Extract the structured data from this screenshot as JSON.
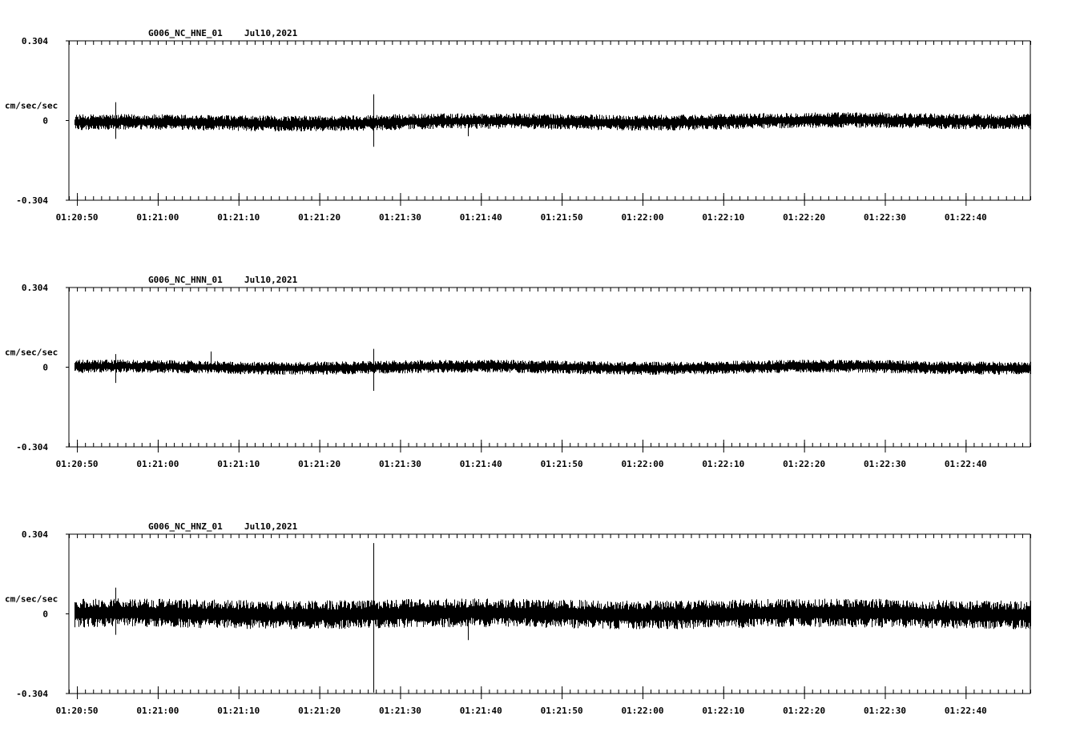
{
  "chart_data": [
    {
      "type": "line",
      "title": "G006_NC_HNE_01",
      "date": "Jul10,2021",
      "ylabel": "cm/sec/sec",
      "ylim": [
        -0.304,
        0.304
      ],
      "y_ticks": [
        "0.304",
        "0",
        "-0.304"
      ],
      "x_ticks": [
        "01:20:50",
        "01:21:00",
        "01:21:10",
        "01:21:20",
        "01:21:30",
        "01:21:40",
        "01:21:50",
        "01:22:00",
        "01:22:10",
        "01:22:20",
        "01:22:30",
        "01:22:40"
      ],
      "x_start_s": 49.0,
      "x_end_s": 168.0,
      "record_start_s": 49.7,
      "noise_amplitude": 0.03,
      "baseline_offset": -0.01,
      "spikes": [
        {
          "t": 54.8,
          "max": 0.07,
          "min": -0.07
        },
        {
          "t": 86.7,
          "max": 0.1,
          "min": -0.1
        },
        {
          "t": 98.4,
          "max": 0.02,
          "min": -0.06
        }
      ],
      "grid": false
    },
    {
      "type": "line",
      "title": "G006_NC_HNN_01",
      "date": "Jul10,2021",
      "ylabel": "cm/sec/sec",
      "ylim": [
        -0.304,
        0.304
      ],
      "y_ticks": [
        "0.304",
        "0",
        "-0.304"
      ],
      "x_ticks": [
        "01:20:50",
        "01:21:00",
        "01:21:10",
        "01:21:20",
        "01:21:30",
        "01:21:40",
        "01:21:50",
        "01:22:00",
        "01:22:10",
        "01:22:20",
        "01:22:30",
        "01:22:40"
      ],
      "x_start_s": 49.0,
      "x_end_s": 168.0,
      "record_start_s": 49.7,
      "noise_amplitude": 0.025,
      "baseline_offset": 0.0,
      "spikes": [
        {
          "t": 54.8,
          "max": 0.05,
          "min": -0.06
        },
        {
          "t": 86.7,
          "max": 0.07,
          "min": -0.09
        },
        {
          "t": 66.6,
          "max": 0.06,
          "min": -0.02
        }
      ],
      "grid": false
    },
    {
      "type": "line",
      "title": "G006_NC_HNZ_01",
      "date": "Jul10,2021",
      "ylabel": "cm/sec/sec",
      "ylim": [
        -0.304,
        0.304
      ],
      "y_ticks": [
        "0.304",
        "0",
        "-0.304"
      ],
      "x_ticks": [
        "01:20:50",
        "01:21:00",
        "01:21:10",
        "01:21:20",
        "01:21:30",
        "01:21:40",
        "01:21:50",
        "01:22:00",
        "01:22:10",
        "01:22:20",
        "01:22:30",
        "01:22:40"
      ],
      "x_start_s": 49.0,
      "x_end_s": 168.0,
      "record_start_s": 49.7,
      "noise_amplitude": 0.055,
      "baseline_offset": 0.0,
      "spikes": [
        {
          "t": 54.8,
          "max": 0.1,
          "min": -0.08
        },
        {
          "t": 86.7,
          "max": 0.27,
          "min": -0.3
        },
        {
          "t": 98.4,
          "max": 0.02,
          "min": -0.1
        }
      ],
      "grid": false
    }
  ]
}
